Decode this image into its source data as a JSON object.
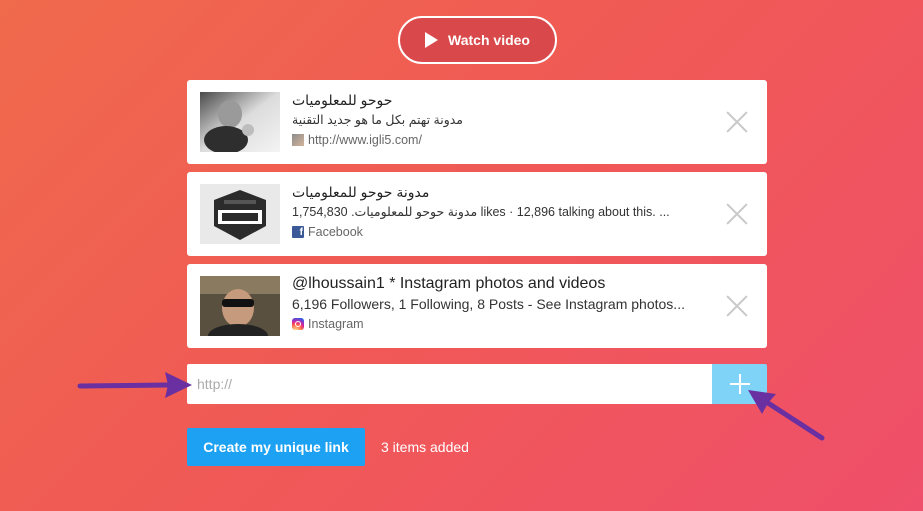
{
  "watch_video": {
    "label": "Watch video"
  },
  "cards": [
    {
      "title": "حوحو للمعلوميات",
      "description": "مدونة تهتم بكل ما هو جديد التقنية",
      "source": "http://www.igli5.com/",
      "source_icon": "site-favicon"
    },
    {
      "title": "مدونة حوحو للمعلوميات",
      "description": "مدونة حوحو للمعلوميات. 1,754,830 likes · 12,896 talking about this. ...",
      "source": "Facebook",
      "source_icon": "facebook-icon"
    },
    {
      "title": "@lhoussain1 * Instagram photos and videos",
      "description": "6,196 Followers, 1 Following, 8 Posts - See Instagram photos...",
      "source": "Instagram",
      "source_icon": "instagram-icon"
    }
  ],
  "url_input": {
    "placeholder": "http://",
    "value": ""
  },
  "create_button": {
    "label": "Create my unique link"
  },
  "items_added": "3 items added",
  "colors": {
    "background_start": "#f06a4c",
    "background_end": "#ef4f6a",
    "watch_button": "#d9494b",
    "create_button": "#1da1f2",
    "add_button": "#7fd3f7",
    "annotation_arrow": "#6a2fa0"
  }
}
